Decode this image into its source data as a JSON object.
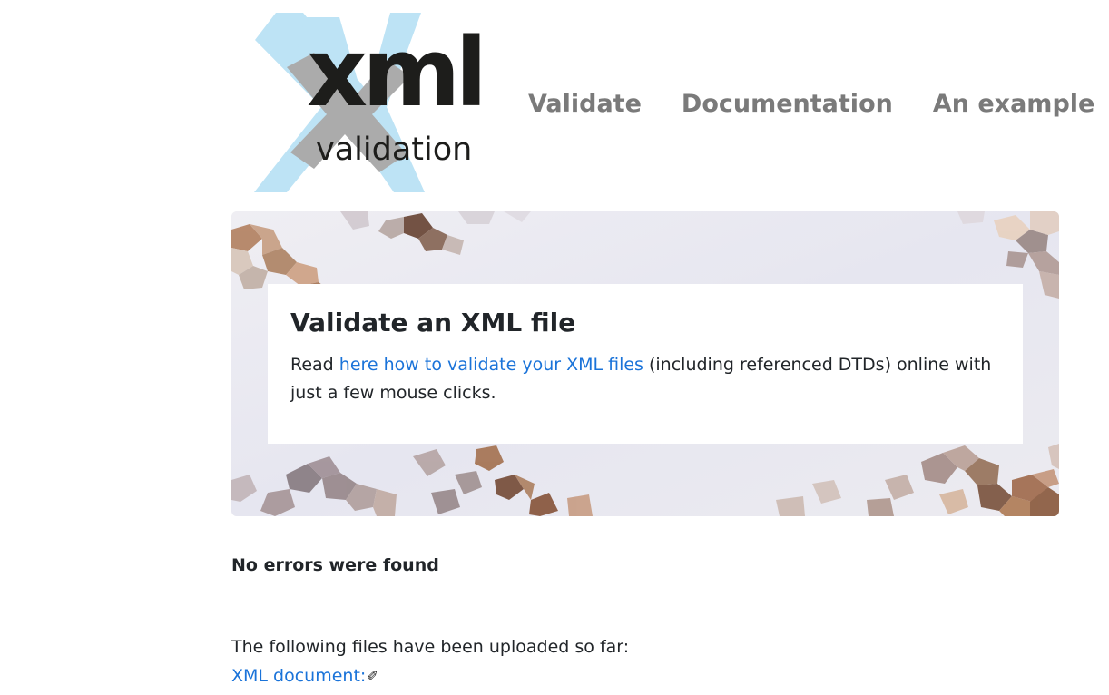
{
  "logo": {
    "word_main": "xml",
    "word_sub": "validation",
    "x_color": "#bde3f5",
    "x_inner_color": "#a9a9a9"
  },
  "nav": {
    "items": [
      {
        "label": "Validate"
      },
      {
        "label": "Documentation"
      },
      {
        "label": "An example"
      }
    ]
  },
  "hero": {
    "title": "Validate an XML file",
    "text_before": "Read ",
    "link_text": "here how to validate your XML files",
    "text_after": " (including referenced DTDs) online with just a few mouse clicks."
  },
  "status": {
    "result": "No errors were found"
  },
  "uploads": {
    "intro": "The following files have been uploaded so far:",
    "files": [
      {
        "label": "XML document:",
        "icon": "pencil-icon"
      }
    ]
  },
  "colors": {
    "link": "#1a73d9",
    "nav": "#7a7a7a",
    "text": "#212529"
  }
}
